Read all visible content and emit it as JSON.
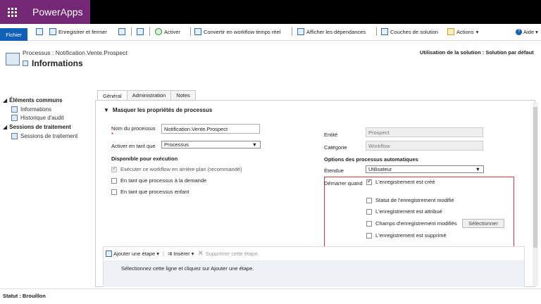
{
  "app": {
    "name": "PowerApps"
  },
  "ribbon": {
    "fichier": "Fichier",
    "save_close": "Enregistrer et fermer",
    "activate": "Activer",
    "convert": "Convertir en workflow temps réel",
    "deps": "Afficher les dépendances",
    "layers": "Couches de solution",
    "actions": "Actions",
    "help": "Aide"
  },
  "header": {
    "breadcrumb": "Processus : Notification.Vente.Prospect",
    "title": "Informations",
    "usage": "Utilisation de la solution : Solution par défaut"
  },
  "nav": {
    "common": "Éléments communs",
    "info": "Informations",
    "audit": "Historique d'audit",
    "sessions_header": "Sessions de traitement",
    "sessions": "Sessions de traitement"
  },
  "tabs": [
    "Général",
    "Administration",
    "Notes"
  ],
  "section": {
    "title": "Masquer les propriétés de processus"
  },
  "form": {
    "process_name_label": "Nom du processus",
    "process_name": "Notification.Vente.Prospect",
    "activate_as_label": "Activer en tant que",
    "activate_as": "Processus",
    "available_title": "Disponible pour exécution",
    "bg": "Exécuter ce workflow en arrière-plan (recommandé)",
    "ondemand": "En tant que processus à la demande",
    "child": "En tant que processus enfant",
    "entity_label": "Entité",
    "entity": "Prospect",
    "category_label": "Catégorie",
    "category": "Workflow",
    "auto_title": "Options des processus automatiques",
    "scope_label": "Étendue",
    "scope": "Utilisateur",
    "start_label": "Démarrer quand",
    "created": "L'enregistrement est créé",
    "status_changed": "Statut de l'enregistrement modifié",
    "assigned": "L'enregistrement est attribué",
    "fields_changed": "Champs d'enregistrement modifiés",
    "select_btn": "Sélectionner",
    "deleted": "L'enregistrement est supprimé"
  },
  "steps": {
    "add": "Ajouter une étape",
    "insert": "Insérer",
    "delete": "Supprimer cette étape.",
    "hint": "Sélectionnez cette ligne et cliquez sur Ajouter une étape."
  },
  "status": {
    "text": "Statut : Brouillon"
  }
}
